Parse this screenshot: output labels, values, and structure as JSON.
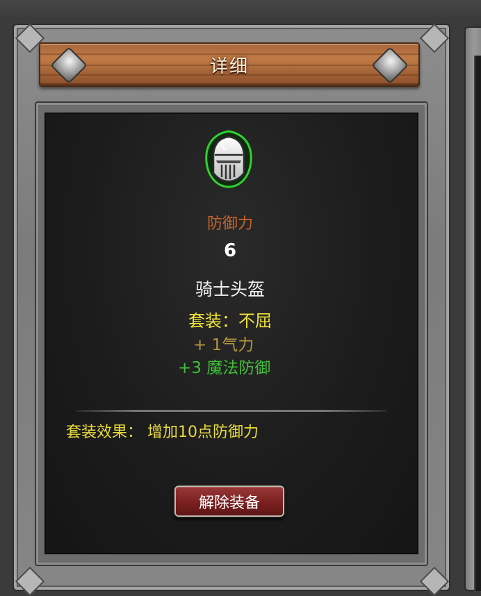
{
  "panel": {
    "title": "详细"
  },
  "item": {
    "icon": "knight-helmet-icon",
    "icon_glow_color": "#2fd12f",
    "stat_label": "防御力",
    "stat_value": "6",
    "name": "骑士头盔",
    "set_name": "套装：不屈",
    "bonuses": [
      {
        "text": "+ 1气力",
        "color": "#b49640"
      },
      {
        "text": "+3 魔法防御",
        "color": "#3fbf3a"
      }
    ],
    "set_effect": "套装效果： 增加10点防御力"
  },
  "actions": {
    "unequip_label": "解除装备"
  },
  "colors": {
    "stat_label": "#c7642a",
    "set_name": "#f1e33a",
    "set_effect": "#e9da3a",
    "button": "#7a2020"
  }
}
